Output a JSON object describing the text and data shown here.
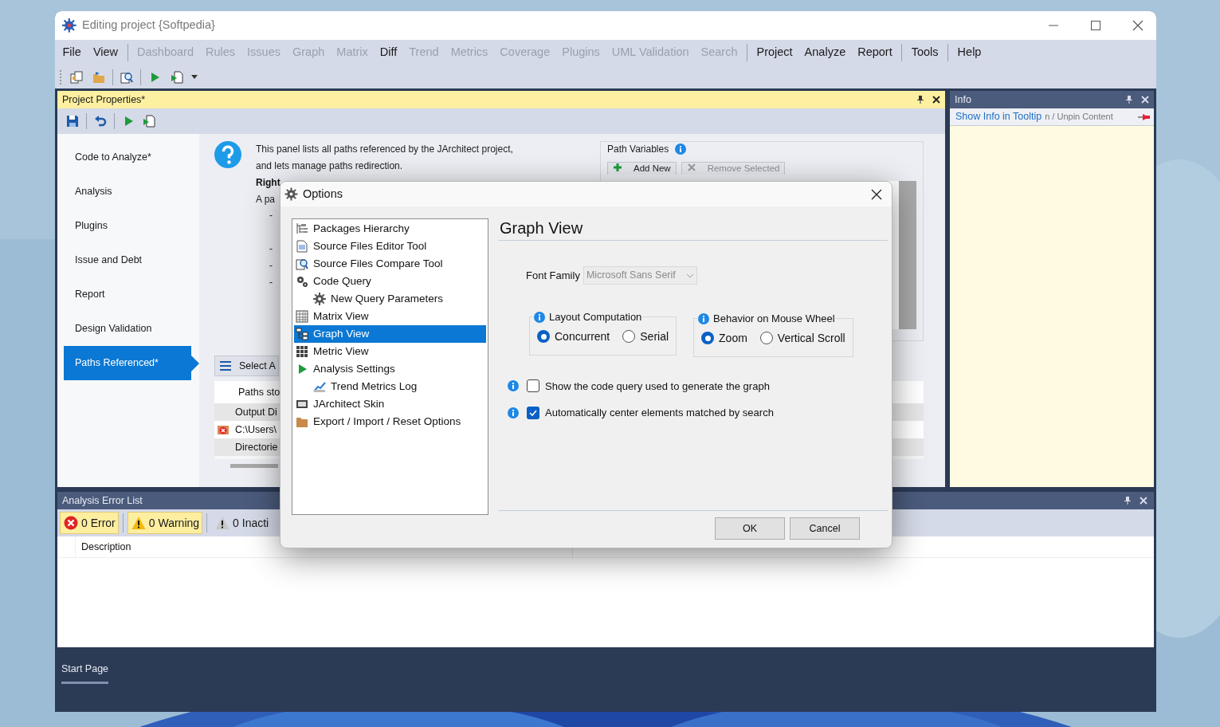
{
  "window": {
    "title": "Editing project {Softpedia}"
  },
  "menu_groups": [
    [
      {
        "label": "File",
        "disabled": false
      },
      {
        "label": "View",
        "disabled": false
      }
    ],
    [
      {
        "label": "Dashboard",
        "disabled": true
      },
      {
        "label": "Rules",
        "disabled": true
      },
      {
        "label": "Issues",
        "disabled": true
      },
      {
        "label": "Graph",
        "disabled": true
      },
      {
        "label": "Matrix",
        "disabled": true
      },
      {
        "label": "Diff",
        "disabled": false
      },
      {
        "label": "Trend",
        "disabled": true
      },
      {
        "label": "Metrics",
        "disabled": true
      },
      {
        "label": "Coverage",
        "disabled": true
      },
      {
        "label": "Plugins",
        "disabled": true
      },
      {
        "label": "UML Validation",
        "disabled": true
      },
      {
        "label": "Search",
        "disabled": true
      }
    ],
    [
      {
        "label": "Project",
        "disabled": false
      },
      {
        "label": "Analyze",
        "disabled": false
      },
      {
        "label": "Report",
        "disabled": false
      }
    ],
    [
      {
        "label": "Tools",
        "disabled": false
      }
    ],
    [
      {
        "label": "Help",
        "disabled": false
      }
    ]
  ],
  "project_properties": {
    "title": "Project Properties*",
    "nav": [
      {
        "label": "Code to Analyze*",
        "selected": false
      },
      {
        "label": "Analysis",
        "selected": false
      },
      {
        "label": "Plugins",
        "selected": false
      },
      {
        "label": "Issue and Debt",
        "selected": false
      },
      {
        "label": "Report",
        "selected": false
      },
      {
        "label": "Design Validation",
        "selected": false
      },
      {
        "label": "Paths Referenced*",
        "selected": true
      }
    ],
    "description": [
      "This panel lists all paths referenced by the JArchitect project,",
      "and lets manage paths redirection."
    ],
    "bold_line": "Right",
    "partial_line": "A pa",
    "bullets": [
      "-",
      "-",
      "-",
      "-"
    ],
    "path_variables": {
      "title": "Path Variables",
      "buttons": [
        {
          "label": "Add New",
          "disabled": false
        },
        {
          "label": "Remove Selected",
          "disabled": true
        }
      ]
    },
    "select_button": "Select A",
    "table": {
      "header": "Paths sto",
      "rows": [
        {
          "text": "Output Di",
          "kind": "group"
        },
        {
          "text": "C:\\Users\\",
          "kind": "path"
        },
        {
          "text": "Directorie",
          "kind": "group"
        }
      ]
    }
  },
  "info_panel": {
    "title": "Info",
    "link": "Show Info in Tooltip",
    "hint": "n / Unpin Content"
  },
  "error_list": {
    "title": "Analysis Error List",
    "filters": [
      {
        "label": "0 Error",
        "kind": "error",
        "on": true
      },
      {
        "label": "0 Warning",
        "kind": "warning",
        "on": true
      },
      {
        "label": "0 Inacti",
        "kind": "inactive",
        "on": false
      }
    ],
    "columns": [
      "Description"
    ]
  },
  "bottom_tabs": [
    {
      "label": "Start Page",
      "selected": true
    }
  ],
  "dialog": {
    "title": "Options",
    "tree": [
      {
        "label": "Packages Hierarchy",
        "selected": false
      },
      {
        "label": "Source Files Editor Tool",
        "selected": false
      },
      {
        "label": "Source Files Compare Tool",
        "selected": false
      },
      {
        "label": "Code Query",
        "selected": false,
        "children": [
          {
            "label": "New Query Parameters",
            "selected": false
          }
        ]
      },
      {
        "label": "Matrix View",
        "selected": false
      },
      {
        "label": "Graph View",
        "selected": true
      },
      {
        "label": "Metric View",
        "selected": false
      },
      {
        "label": "Analysis Settings",
        "selected": false,
        "children": [
          {
            "label": "Trend Metrics Log",
            "selected": false
          }
        ]
      },
      {
        "label": "JArchitect Skin",
        "selected": false
      },
      {
        "label": "Export / Import / Reset Options",
        "selected": false
      }
    ],
    "heading": "Graph View",
    "font_family": {
      "label": "Font Family",
      "value": "Microsoft Sans Serif",
      "disabled": true
    },
    "groups": [
      {
        "title": "Layout Computation",
        "options": [
          {
            "label": "Concurrent",
            "selected": true
          },
          {
            "label": "Serial",
            "selected": false
          }
        ]
      },
      {
        "title": "Behavior on Mouse Wheel",
        "options": [
          {
            "label": "Zoom",
            "selected": true
          },
          {
            "label": "Vertical Scroll",
            "selected": false
          }
        ]
      }
    ],
    "checkboxes": [
      {
        "label": "Show the code query used to generate the graph",
        "checked": false
      },
      {
        "label": "Automatically center elements matched by search",
        "checked": true
      }
    ],
    "buttons": [
      "OK",
      "Cancel"
    ]
  }
}
